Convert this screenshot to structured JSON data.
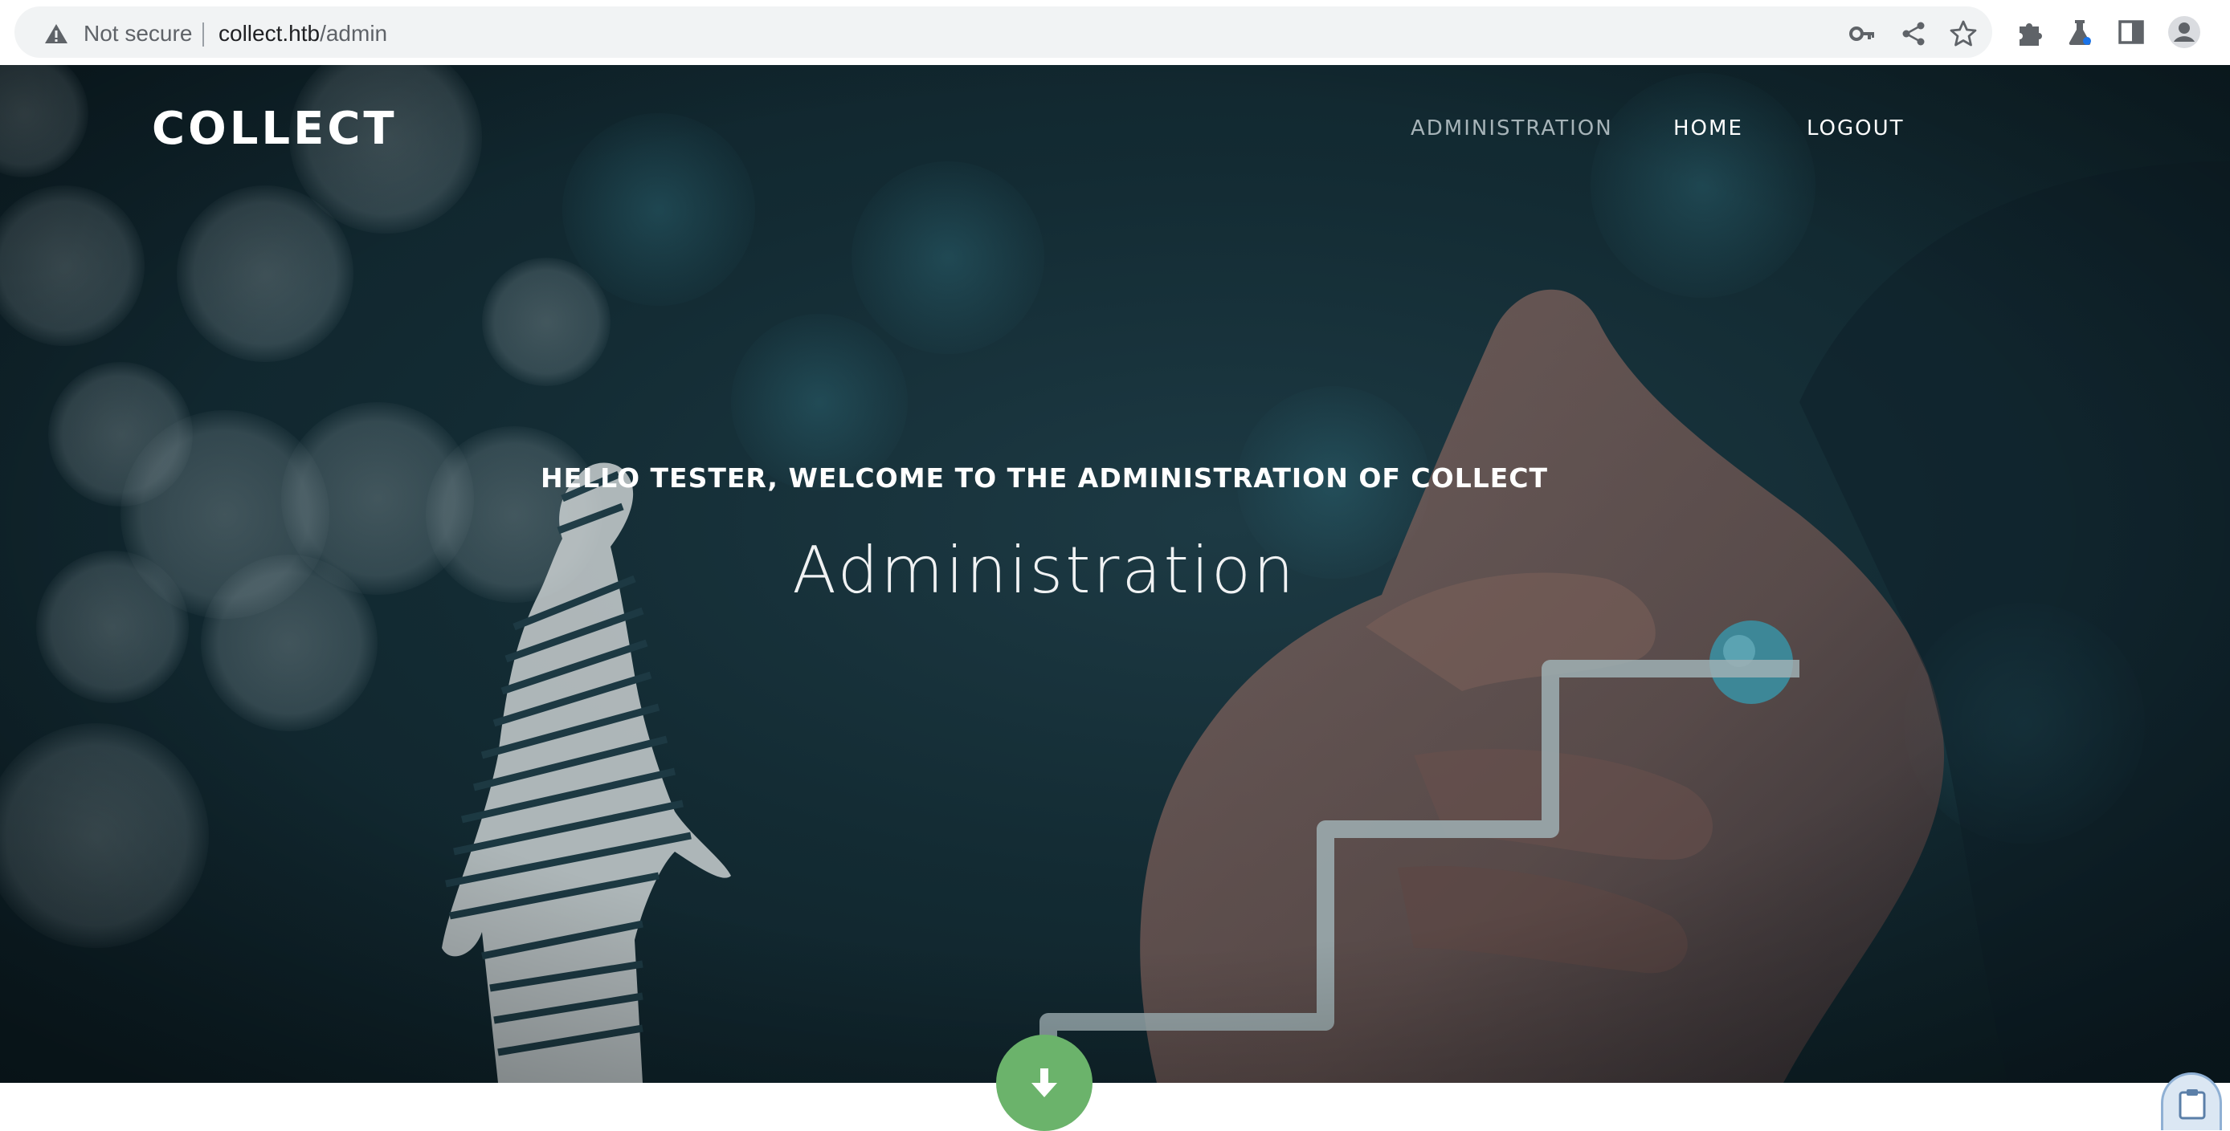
{
  "browser": {
    "security_label": "Not secure",
    "url_host": "collect.htb",
    "url_path": "/admin",
    "icons": [
      "warning-icon",
      "key-icon",
      "share-icon",
      "star-icon",
      "extensions-icon",
      "labs-icon",
      "side-panel-icon",
      "profile-icon"
    ]
  },
  "site": {
    "logo": "COLLECT",
    "nav": [
      {
        "label": "ADMINISTRATION",
        "active": true
      },
      {
        "label": "HOME",
        "active": false
      },
      {
        "label": "LOGOUT",
        "active": false
      }
    ]
  },
  "hero": {
    "welcome": "HELLO TESTER, WELCOME TO THE ADMINISTRATION OF COLLECT",
    "title": "Administration"
  },
  "colors": {
    "hero_dark": "#132b33",
    "scroll_button": "#6bb36b",
    "nav_active": "#a6b3b8",
    "text": "#ffffff"
  },
  "controls": {
    "scroll_down_icon": "arrow-down-icon",
    "corner_widget_icon": "clipboard-icon"
  }
}
